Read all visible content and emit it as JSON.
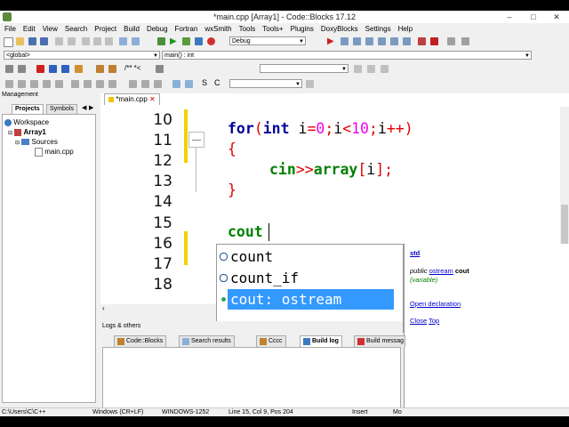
{
  "window": {
    "title": "*main.cpp [Array1] - Code::Blocks 17.12",
    "minimize": "–",
    "maximize": "□",
    "close": "✕"
  },
  "menu": [
    "File",
    "Edit",
    "View",
    "Search",
    "Project",
    "Build",
    "Debug",
    "Fortran",
    "wxSmith",
    "Tools",
    "Tools+",
    "Plugins",
    "DoxyBlocks",
    "Settings",
    "Help"
  ],
  "toolbar": {
    "build_target": "Debug",
    "scope": "<global>",
    "function": "main() : int",
    "comment_btn": "/** *<",
    "icon_s": "S",
    "icon_c": "C"
  },
  "management": {
    "title": "Management",
    "tabs": [
      "Projects",
      "Symbols"
    ],
    "tree": {
      "workspace": "Workspace",
      "project": "Array1",
      "folder": "Sources",
      "file": "main.cpp"
    }
  },
  "editor": {
    "tab": "*main.cpp",
    "line_numbers": [
      "10",
      "11",
      "12",
      "13",
      "14",
      "15",
      "16",
      "17",
      "18"
    ],
    "lines": {
      "l10": {
        "kw1": "for",
        "p1": "(",
        "kw2": "int",
        "sp": " ",
        "v1": "i",
        "eq": "=",
        "n0": "0",
        "s1": ";",
        "v2": "i",
        "lt": "<",
        "n10": "10",
        "s2": ";",
        "v3": "i",
        "inc": "++",
        "p2": ")"
      },
      "l11": "{",
      "l12": {
        "cin": "cin",
        "op": ">>",
        "arr": "array",
        "b1": "[",
        "i": "i",
        "b2": "]",
        "semi": ";"
      },
      "l13": "}",
      "l15": "cout"
    }
  },
  "autocomplete": {
    "items": [
      "count",
      "count_if",
      "cout: ostream"
    ],
    "selected_index": 2,
    "doc": {
      "namespace": "std",
      "decl_prefix": "public",
      "decl_type": "ostream",
      "decl_name": "cout",
      "kind": "(variable)",
      "open_decl": "Open declaration",
      "close": "Close",
      "top": "Top"
    }
  },
  "logs": {
    "title": "Logs & others",
    "tabs": [
      "Code::Blocks",
      "Search results",
      "Cccc",
      "Build log",
      "Build messag"
    ]
  },
  "status_bar": {
    "path": "C:\\Users\\C\\C++",
    "eol": "Windows (CR+LF)",
    "encoding": "WINDOWS-1252",
    "position": "Line 15, Col 9, Pos 204",
    "insert": "Insert",
    "modified": "Mo"
  }
}
